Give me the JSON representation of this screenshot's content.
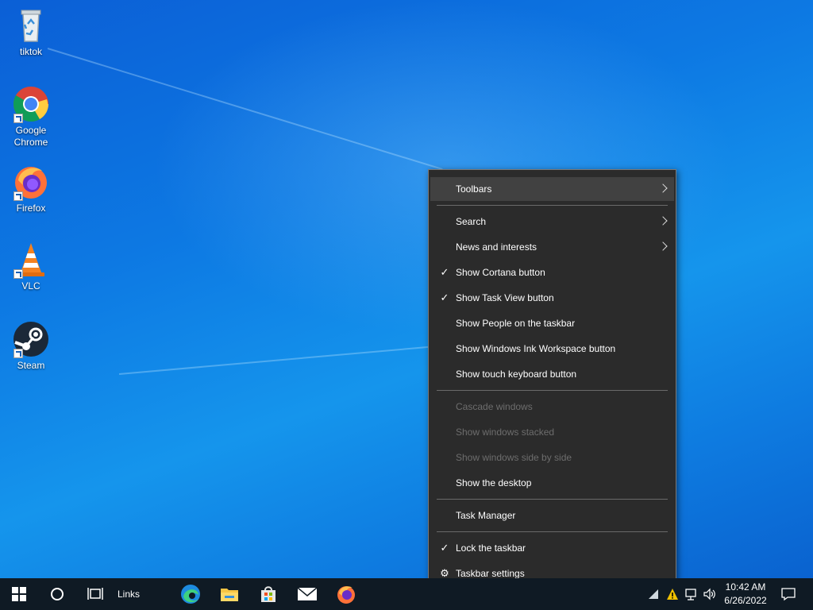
{
  "desktop": {
    "icons": [
      {
        "label": "tiktok"
      },
      {
        "label": "Google Chrome"
      },
      {
        "label": "Firefox"
      },
      {
        "label": "VLC"
      },
      {
        "label": "Steam"
      }
    ]
  },
  "context_menu": {
    "items": [
      {
        "label": "Toolbars",
        "submenu": true,
        "checked": false,
        "enabled": true,
        "hover": true
      },
      {
        "label": "Search",
        "submenu": true,
        "checked": false,
        "enabled": true
      },
      {
        "label": "News and interests",
        "submenu": true,
        "checked": false,
        "enabled": true
      },
      {
        "label": "Show Cortana button",
        "checked": true,
        "enabled": true
      },
      {
        "label": "Show Task View button",
        "checked": true,
        "enabled": true
      },
      {
        "label": "Show People on the taskbar",
        "checked": false,
        "enabled": true
      },
      {
        "label": "Show Windows Ink Workspace button",
        "checked": false,
        "enabled": true
      },
      {
        "label": "Show touch keyboard button",
        "checked": false,
        "enabled": true
      },
      {
        "label": "Cascade windows",
        "checked": false,
        "enabled": false
      },
      {
        "label": "Show windows stacked",
        "checked": false,
        "enabled": false
      },
      {
        "label": "Show windows side by side",
        "checked": false,
        "enabled": false
      },
      {
        "label": "Show the desktop",
        "checked": false,
        "enabled": true
      },
      {
        "label": "Task Manager",
        "checked": false,
        "enabled": true
      },
      {
        "label": "Lock the taskbar",
        "checked": true,
        "enabled": true
      },
      {
        "label": "Taskbar settings",
        "icon": "gear-icon",
        "enabled": true
      }
    ],
    "check_glyph": "✓",
    "gear_glyph": "⚙"
  },
  "taskbar": {
    "links_label": "Links",
    "apps": [
      "edge-icon",
      "file-explorer-icon",
      "microsoft-store-icon",
      "mail-icon",
      "firefox-icon"
    ],
    "clock": {
      "time": "10:42 AM",
      "date": "6/26/2022"
    }
  },
  "colors": {
    "menu_bg": "#2b2b2b",
    "menu_hover": "#414141",
    "menu_disabled_text": "#6d6d6d",
    "taskbar_bg": "#0f1a24",
    "desktop_blue": "#0d79e3"
  }
}
